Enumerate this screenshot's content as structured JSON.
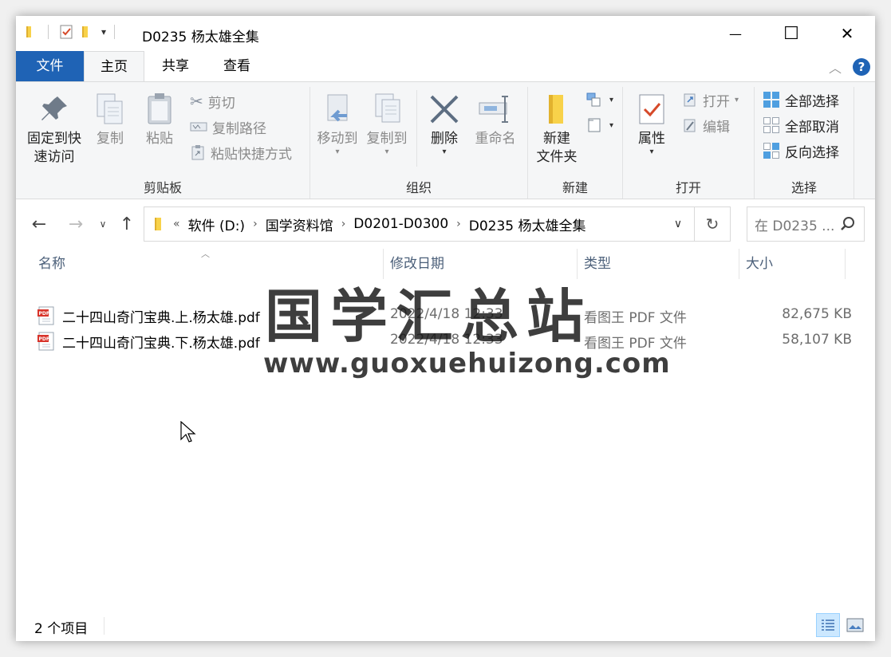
{
  "window": {
    "title": "D0235 杨太雄全集",
    "controls": {
      "minimize": "—",
      "maximize": "☐",
      "close": "✕"
    }
  },
  "tabs": [
    {
      "label": "文件",
      "active": false
    },
    {
      "label": "主页",
      "active": true
    },
    {
      "label": "共享",
      "active": false
    },
    {
      "label": "查看",
      "active": false
    }
  ],
  "ribbon": {
    "clipboard": {
      "label": "剪贴板",
      "pin": {
        "line1": "固定到快",
        "line2": "速访问"
      },
      "copy": "复制",
      "paste": "粘贴",
      "cut": "剪切",
      "copy_path": "复制路径",
      "paste_shortcut": "粘贴快捷方式"
    },
    "organize": {
      "label": "组织",
      "move_to": "移动到",
      "copy_to": "复制到",
      "delete": "删除",
      "rename": "重命名"
    },
    "new": {
      "label": "新建",
      "new_folder": {
        "line1": "新建",
        "line2": "文件夹"
      }
    },
    "open": {
      "label": "打开",
      "properties": "属性",
      "open": "打开",
      "edit": "编辑"
    },
    "select": {
      "label": "选择",
      "select_all": "全部选择",
      "select_none": "全部取消",
      "invert": "反向选择"
    }
  },
  "address": {
    "overflow": "«",
    "crumbs": [
      "软件 (D:)",
      "国学资料馆",
      "D0201-D0300",
      "D0235 杨太雄全集"
    ],
    "search_placeholder": "在 D0235 ..."
  },
  "columns": {
    "name": "名称",
    "modified": "修改日期",
    "type": "类型",
    "size": "大小"
  },
  "files": [
    {
      "name": "二十四山奇门宝典.上.杨太雄.pdf",
      "modified": "2022/4/18 12:33",
      "type": "看图王 PDF 文件",
      "size": "82,675 KB"
    },
    {
      "name": "二十四山奇门宝典.下.杨太雄.pdf",
      "modified": "2022/4/18 12:33",
      "type": "看图王 PDF 文件",
      "size": "58,107 KB"
    }
  ],
  "status": {
    "items": "2 个项目"
  },
  "watermark": {
    "title": "国学汇总站",
    "url": "www.guoxuehuizong.com"
  },
  "colors": {
    "accent": "#1f63b5",
    "ribbon_bg": "#f5f6f7",
    "folder": "#f8d24a"
  }
}
